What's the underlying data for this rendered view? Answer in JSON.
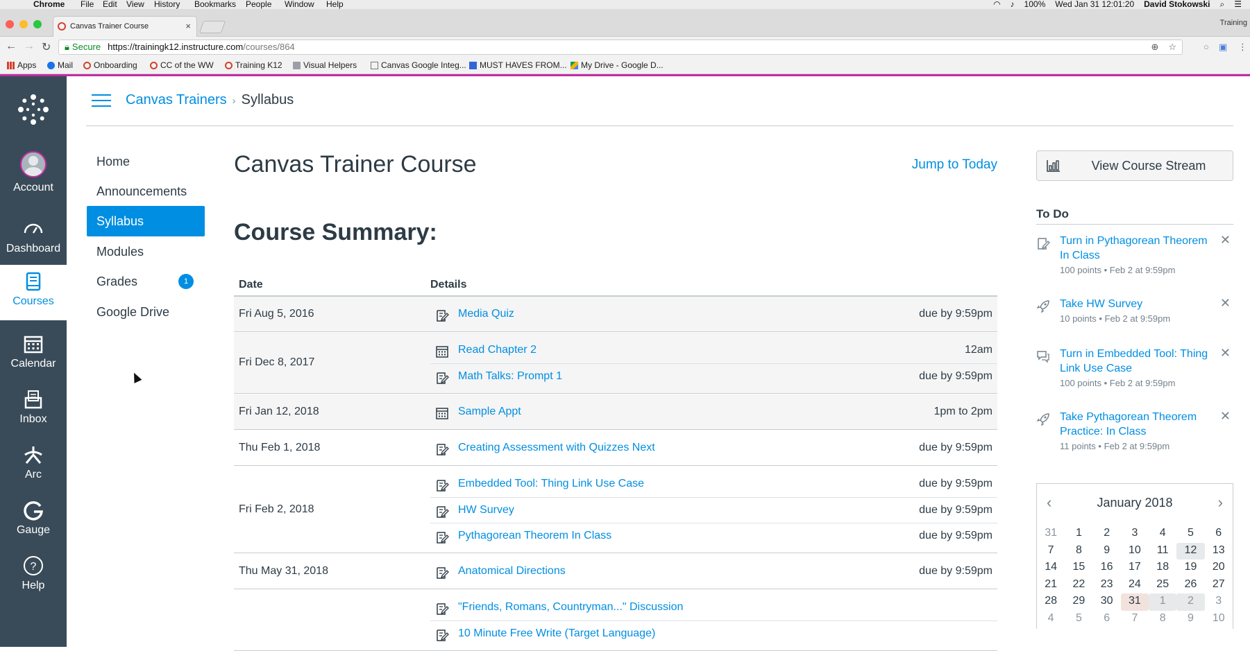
{
  "os_menubar": {
    "app_name": "Chrome",
    "menus": [
      "File",
      "Edit",
      "View",
      "History",
      "Bookmarks",
      "People",
      "Window",
      "Help"
    ],
    "battery": "100%",
    "datetime": "Wed Jan 31  12:01:20",
    "user": "David Stokowski"
  },
  "browser": {
    "tab_title": "Canvas Trainer Course",
    "profile_label": "Training",
    "secure_label": "Secure",
    "url_host": "https://trainingk12.instructure.com",
    "url_path": "/courses/864",
    "bookmarks": [
      "Apps",
      "Mail",
      "Onboarding",
      "CC of the WW",
      "Training K12",
      "Visual Helpers",
      "Canvas Google Integ...",
      "MUST HAVES FROM...",
      "My Drive - Google D..."
    ]
  },
  "global_nav": {
    "items": [
      {
        "label": "Account",
        "icon": "account-avatar"
      },
      {
        "label": "Dashboard",
        "icon": "dashboard-icon"
      },
      {
        "label": "Courses",
        "icon": "courses-icon"
      },
      {
        "label": "Calendar",
        "icon": "calendar-icon"
      },
      {
        "label": "Inbox",
        "icon": "inbox-icon"
      },
      {
        "label": "Arc",
        "icon": "arc-icon"
      },
      {
        "label": "Gauge",
        "icon": "gauge-icon"
      },
      {
        "label": "Help",
        "icon": "help-icon"
      }
    ],
    "active_index": 2
  },
  "breadcrumb": {
    "course": "Canvas Trainers",
    "separator": "›",
    "current": "Syllabus"
  },
  "course_nav": {
    "items": [
      {
        "label": "Home"
      },
      {
        "label": "Announcements"
      },
      {
        "label": "Syllabus"
      },
      {
        "label": "Modules"
      },
      {
        "label": "Grades",
        "badge": "1"
      },
      {
        "label": "Google Drive"
      }
    ],
    "active_index": 2
  },
  "main": {
    "course_title": "Canvas Trainer Course",
    "jump_today": "Jump to Today",
    "summary_title": "Course Summary:",
    "columns": {
      "date": "Date",
      "details": "Details"
    },
    "rows": [
      {
        "date": "Fri Aug 5, 2016",
        "events": [
          {
            "icon": "assignment-icon",
            "name": "Media Quiz",
            "due": "due by 9:59pm"
          }
        ]
      },
      {
        "date": "Fri Dec 8, 2017",
        "events": [
          {
            "icon": "calendar-event-icon",
            "name": "Read Chapter 2",
            "due": "12am"
          },
          {
            "icon": "assignment-icon",
            "name": "Math Talks: Prompt 1",
            "due": "due by 9:59pm"
          }
        ]
      },
      {
        "date": "Fri Jan 12, 2018",
        "events": [
          {
            "icon": "calendar-event-icon",
            "name": "Sample Appt",
            "due": "1pm to 2pm"
          }
        ]
      },
      {
        "date": "Thu Feb 1, 2018",
        "events": [
          {
            "icon": "assignment-icon",
            "name": "Creating Assessment with Quizzes Next",
            "due": "due by 9:59pm"
          }
        ]
      },
      {
        "date": "Fri Feb 2, 2018",
        "events": [
          {
            "icon": "assignment-icon",
            "name": "Embedded Tool: Thing Link Use Case",
            "due": "due by 9:59pm"
          },
          {
            "icon": "assignment-icon",
            "name": "HW Survey",
            "due": "due by 9:59pm"
          },
          {
            "icon": "assignment-icon",
            "name": "Pythagorean Theorem In Class",
            "due": "due by 9:59pm"
          }
        ]
      },
      {
        "date": "Thu May 31, 2018",
        "events": [
          {
            "icon": "assignment-icon",
            "name": "Anatomical Directions",
            "due": "due by 9:59pm"
          }
        ]
      },
      {
        "date": "",
        "events": [
          {
            "icon": "assignment-icon",
            "name": "\"Friends, Romans, Countryman...\" Discussion",
            "due": ""
          },
          {
            "icon": "assignment-icon",
            "name": "10 Minute Free Write (Target Language)",
            "due": ""
          }
        ]
      }
    ]
  },
  "sidebar": {
    "stream_button": "View Course Stream",
    "todo_title": "To Do",
    "todo": [
      {
        "icon": "assignment-icon",
        "title": "Turn in Pythagorean Theorem In Class",
        "meta": "100 points • Feb 2 at 9:59pm"
      },
      {
        "icon": "rocket-icon",
        "title": "Take HW Survey",
        "meta": "10 points • Feb 2 at 9:59pm"
      },
      {
        "icon": "discussion-icon",
        "title": "Turn in Embedded Tool: Thing Link Use Case",
        "meta": "100 points • Feb 2 at 9:59pm"
      },
      {
        "icon": "rocket-icon",
        "title": "Take Pythagorean Theorem Practice: In Class",
        "meta": "11 points • Feb 2 at 9:59pm"
      }
    ],
    "calendar": {
      "month": "January 2018",
      "weeks": [
        [
          "31",
          "1",
          "2",
          "3",
          "4",
          "5",
          "6"
        ],
        [
          "7",
          "8",
          "9",
          "10",
          "11",
          "12",
          "13"
        ],
        [
          "14",
          "15",
          "16",
          "17",
          "18",
          "19",
          "20"
        ],
        [
          "21",
          "22",
          "23",
          "24",
          "25",
          "26",
          "27"
        ],
        [
          "28",
          "29",
          "30",
          "31",
          "1",
          "2",
          "3"
        ],
        [
          "4",
          "5",
          "6",
          "7",
          "8",
          "9",
          "10"
        ]
      ]
    }
  },
  "colors": {
    "nav_bg": "#394b58",
    "link_blue": "#008ee2",
    "brand_magenta": "#c12ca3"
  }
}
